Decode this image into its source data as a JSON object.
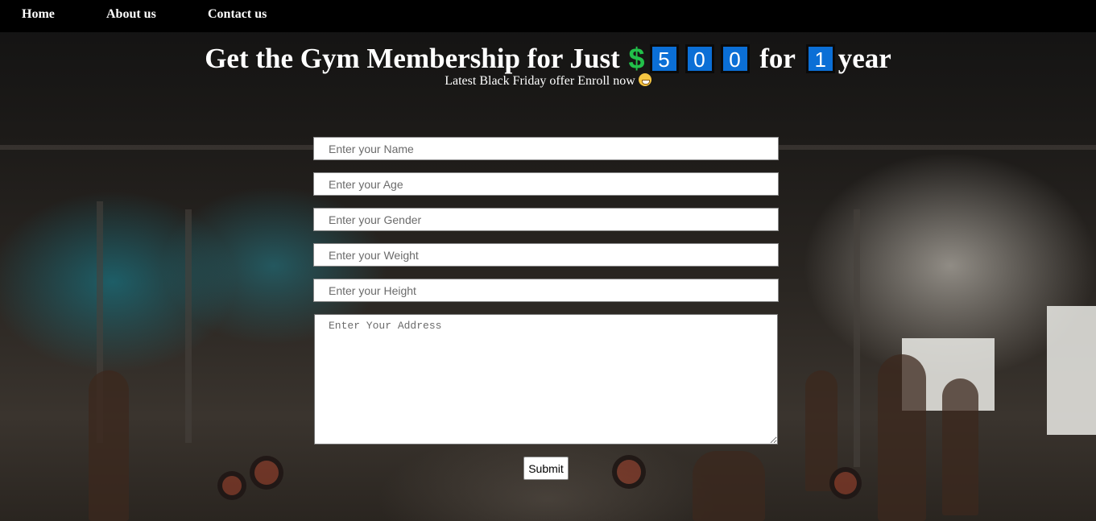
{
  "nav": {
    "items": [
      {
        "label": "Home"
      },
      {
        "label": "About us"
      },
      {
        "label": "Contact us"
      }
    ]
  },
  "hero": {
    "title_prefix": "Get the Gym Membership for Just",
    "currency_symbol": "$",
    "price_digits": [
      "5",
      "0",
      "0"
    ],
    "title_middle": "for",
    "duration_digit": "1",
    "title_suffix": "year",
    "subtitle": "Latest Black Friday offer Enroll now"
  },
  "form": {
    "name_placeholder": "Enter your Name",
    "age_placeholder": "Enter your Age",
    "gender_placeholder": "Enter your Gender",
    "weight_placeholder": "Enter your Weight",
    "height_placeholder": "Enter your Height",
    "address_placeholder": "Enter Your Address",
    "submit_label": "Submit"
  },
  "colors": {
    "nav_background": "#000000",
    "digit_background": "#0b6fd6",
    "dollar_color": "#22c04a",
    "text_color": "#ffffff"
  },
  "icons": {
    "emoji": "grinning-face-icon"
  }
}
